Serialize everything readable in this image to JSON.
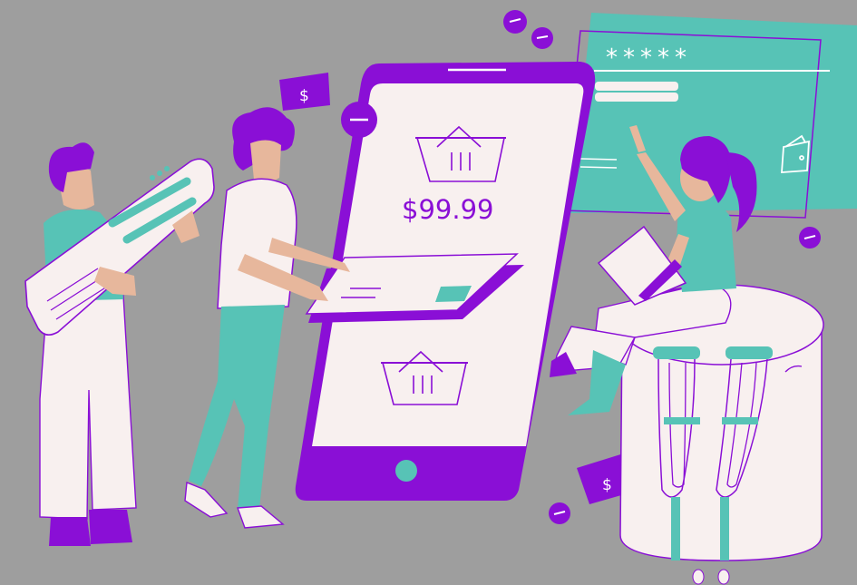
{
  "illustration": {
    "price": "$99.99",
    "masked_password": "*****",
    "currency_symbol": "$",
    "minus_symbol": "–"
  },
  "colors": {
    "background": "#9e9e9e",
    "purple": "#8a0fd6",
    "teal": "#57c3b6",
    "cream": "#f8f0ef",
    "skin": "#e7b79c"
  },
  "icons": [
    "shopping-basket-icon",
    "wallet-icon",
    "dollar-bill-icon",
    "minus-coin-icon"
  ]
}
